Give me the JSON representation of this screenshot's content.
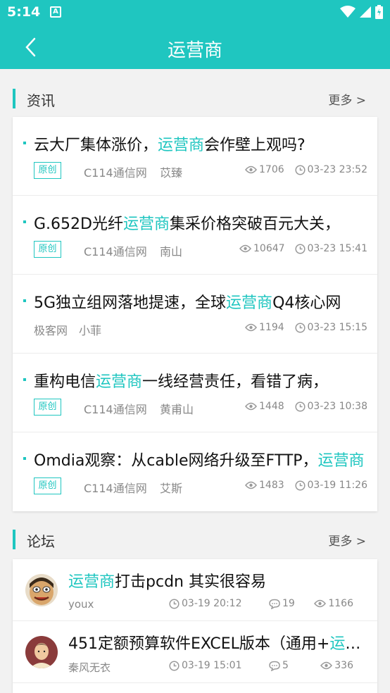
{
  "status_bar": {
    "time": "5:14",
    "notification_icon": "A"
  },
  "header": {
    "title": "运营商"
  },
  "colors": {
    "accent": "#1fc6c0"
  },
  "news_section": {
    "title": "资讯",
    "more": "更多 >",
    "items": [
      {
        "pre": "云大厂集体涨价，",
        "hl": "运营商",
        "post": "会作壁上观吗?",
        "tag": "原创",
        "source": "C114通信网",
        "author": "苡臻",
        "views": "1706",
        "date": "03-23 23:52"
      },
      {
        "pre": "G.652D光纤",
        "hl": "运营商",
        "post": "集采价格突破百元大关，",
        "tag": "原创",
        "source": "C114通信网",
        "author": "南山",
        "views": "10647",
        "date": "03-23 15:41"
      },
      {
        "pre": "5G独立组网落地提速，全球",
        "hl": "运营商",
        "post": "Q4核心网",
        "tag": "",
        "source": "极客网",
        "author": "小菲",
        "views": "1194",
        "date": "03-23 15:15"
      },
      {
        "pre": "重构电信",
        "hl": "运营商",
        "post": "一线经营责任，看错了病，",
        "tag": "原创",
        "source": "C114通信网",
        "author": "黄甫山",
        "views": "1448",
        "date": "03-23 10:38"
      },
      {
        "pre": "Omdia观察：从cable网络升级至FTTP，",
        "hl": "运营商",
        "post": "",
        "tag": "原创",
        "source": "C114通信网",
        "author": "艾斯",
        "views": "1483",
        "date": "03-19 11:26"
      }
    ]
  },
  "forum_section": {
    "title": "论坛",
    "more": "更多 >",
    "items": [
      {
        "pre": "",
        "hl": "运营商",
        "post": "打击pcdn 其实很容易",
        "author": "youx",
        "date": "03-19 20:12",
        "replies": "19",
        "views": "1166",
        "avatar": "cartoon-face"
      },
      {
        "pre": "451定额预算软件EXCEL版本（通用+",
        "hl": "运营商",
        "post": "",
        "author": "秦风无衣",
        "date": "03-19 15:01",
        "replies": "5",
        "views": "336",
        "avatar": "person"
      }
    ]
  }
}
